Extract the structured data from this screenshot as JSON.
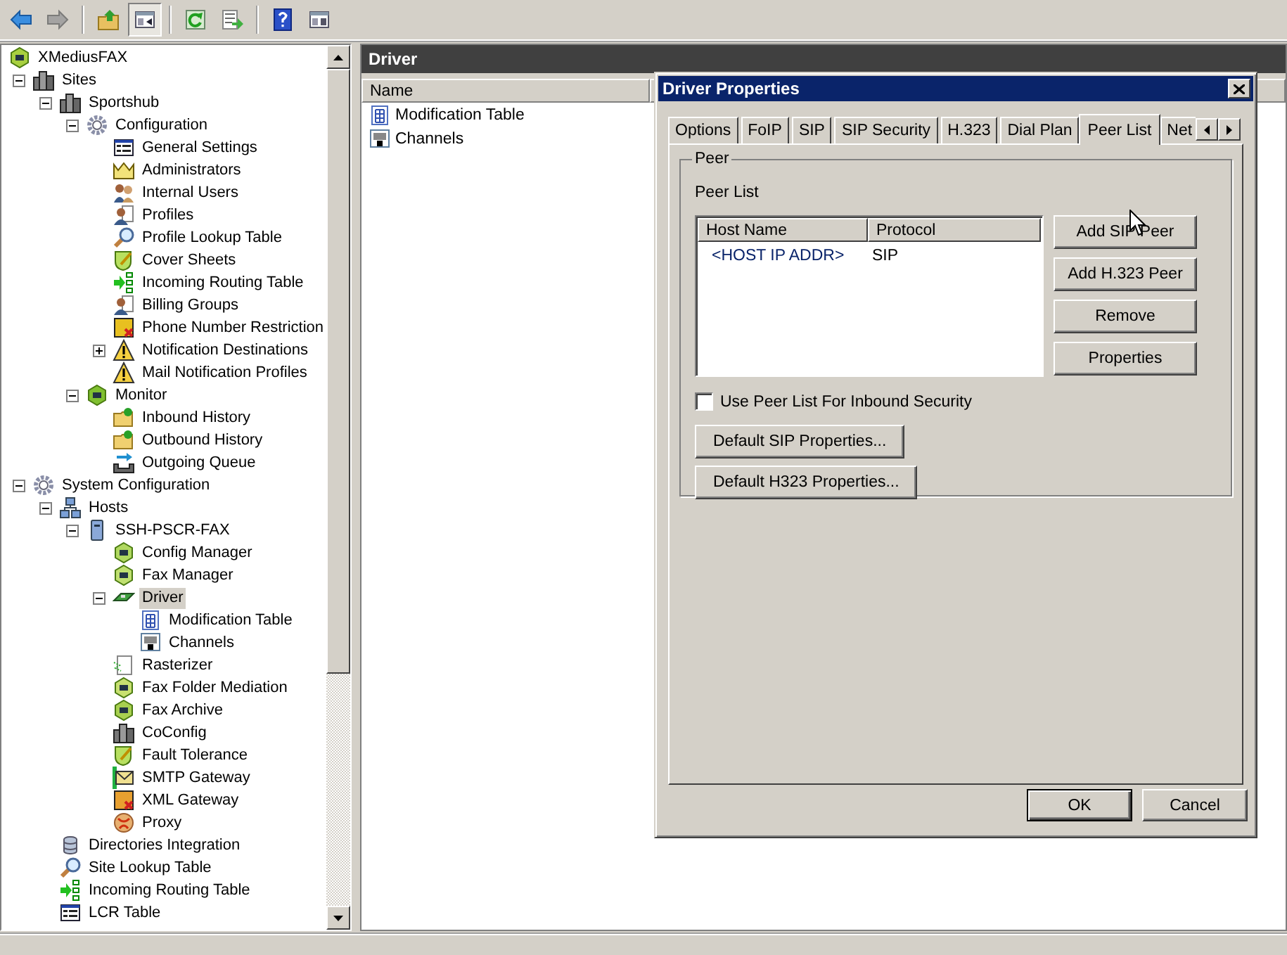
{
  "toolbar": [
    [
      {
        "kind": "back",
        "disabled": false,
        "pressed": false
      },
      {
        "kind": "forward",
        "disabled": true,
        "pressed": false
      }
    ],
    [
      {
        "kind": "up",
        "disabled": false,
        "pressed": false
      },
      {
        "kind": "view",
        "disabled": false,
        "pressed": true
      }
    ],
    [
      {
        "kind": "refresh",
        "disabled": false,
        "pressed": false
      },
      {
        "kind": "export",
        "disabled": false,
        "pressed": false
      }
    ],
    [
      {
        "kind": "help",
        "disabled": false,
        "pressed": false
      },
      {
        "kind": "panel",
        "disabled": false,
        "pressed": false
      }
    ]
  ],
  "tree": {
    "label": "XMediusFAX",
    "selected": false,
    "children": [
      {
        "label": "Sites",
        "selected": false,
        "expanded": true,
        "children": [
          {
            "label": "Sportshub",
            "selected": false,
            "expanded": true,
            "children": [
              {
                "label": "Configuration",
                "selected": false,
                "expanded": true,
                "children": [
                  {
                    "label": "General Settings",
                    "selected": false
                  },
                  {
                    "label": "Administrators",
                    "selected": false
                  },
                  {
                    "label": "Internal Users",
                    "selected": false
                  },
                  {
                    "label": "Profiles",
                    "selected": false
                  },
                  {
                    "label": "Profile Lookup Table",
                    "selected": false
                  },
                  {
                    "label": "Cover Sheets",
                    "selected": false
                  },
                  {
                    "label": "Incoming Routing Table",
                    "selected": false
                  },
                  {
                    "label": "Billing Groups",
                    "selected": false
                  },
                  {
                    "label": "Phone Number Restriction",
                    "selected": false
                  },
                  {
                    "label": "Notification Destinations",
                    "selected": false,
                    "expanded": false
                  },
                  {
                    "label": "Mail Notification Profiles",
                    "selected": false
                  }
                ]
              },
              {
                "label": "Monitor",
                "selected": false,
                "expanded": true,
                "children": [
                  {
                    "label": "Inbound History",
                    "selected": false
                  },
                  {
                    "label": "Outbound History",
                    "selected": false
                  },
                  {
                    "label": "Outgoing Queue",
                    "selected": false
                  }
                ]
              }
            ]
          }
        ]
      },
      {
        "label": "System Configuration",
        "selected": false,
        "expanded": true,
        "children": [
          {
            "label": "Hosts",
            "selected": false,
            "expanded": true,
            "children": [
              {
                "label": "SSH-PSCR-FAX",
                "selected": false,
                "expanded": true,
                "children": [
                  {
                    "label": "Config Manager",
                    "selected": false
                  },
                  {
                    "label": "Fax Manager",
                    "selected": false
                  },
                  {
                    "label": "Driver",
                    "selected": true,
                    "expanded": true,
                    "children": [
                      {
                        "label": "Modification Table",
                        "selected": false
                      },
                      {
                        "label": "Channels",
                        "selected": false
                      }
                    ]
                  },
                  {
                    "label": "Rasterizer",
                    "selected": false
                  },
                  {
                    "label": "Fax Folder Mediation",
                    "selected": false
                  },
                  {
                    "label": "Fax Archive",
                    "selected": false
                  },
                  {
                    "label": "CoConfig",
                    "selected": false
                  },
                  {
                    "label": "Fault Tolerance",
                    "selected": false
                  },
                  {
                    "label": "SMTP Gateway",
                    "selected": false
                  },
                  {
                    "label": "XML Gateway",
                    "selected": false
                  },
                  {
                    "label": "Proxy",
                    "selected": false
                  }
                ]
              }
            ]
          },
          {
            "label": "Directories Integration",
            "selected": false
          },
          {
            "label": "Site Lookup Table",
            "selected": false
          },
          {
            "label": "Incoming Routing Table",
            "selected": false
          },
          {
            "label": "LCR Table",
            "selected": false
          }
        ]
      }
    ]
  },
  "details": {
    "title": "Driver",
    "columns": [
      "Name"
    ],
    "items": [
      {
        "label": "Modification Table",
        "selected": false
      },
      {
        "label": "Channels",
        "selected": false
      }
    ]
  },
  "dialog": {
    "title": "Driver Properties",
    "tabs": [
      {
        "label": "Options",
        "selected": false
      },
      {
        "label": "FoIP",
        "selected": false
      },
      {
        "label": "SIP",
        "selected": false
      },
      {
        "label": "SIP Security",
        "selected": false
      },
      {
        "label": "H.323",
        "selected": false
      },
      {
        "label": "Dial Plan",
        "selected": false
      },
      {
        "label": "Peer List",
        "selected": true
      },
      {
        "label": "Net",
        "selected": false
      }
    ],
    "group": {
      "legend": "Peer",
      "list_label": "Peer List",
      "columns": [
        "Host Name",
        "Protocol"
      ],
      "rows": [
        {
          "cells": [
            "<HOST IP ADDR>",
            "SIP"
          ],
          "selected": false
        }
      ],
      "side_buttons": [
        "Add SIP Peer",
        "Add H.323 Peer",
        "Remove",
        "Properties"
      ],
      "checkbox": {
        "label": "Use Peer List For Inbound Security",
        "checked": false
      },
      "buttons": [
        "Default SIP Properties...",
        "Default H323 Properties..."
      ]
    },
    "footer_buttons": [
      {
        "label": "OK",
        "default": true
      },
      {
        "label": "Cancel",
        "default": false
      }
    ]
  }
}
